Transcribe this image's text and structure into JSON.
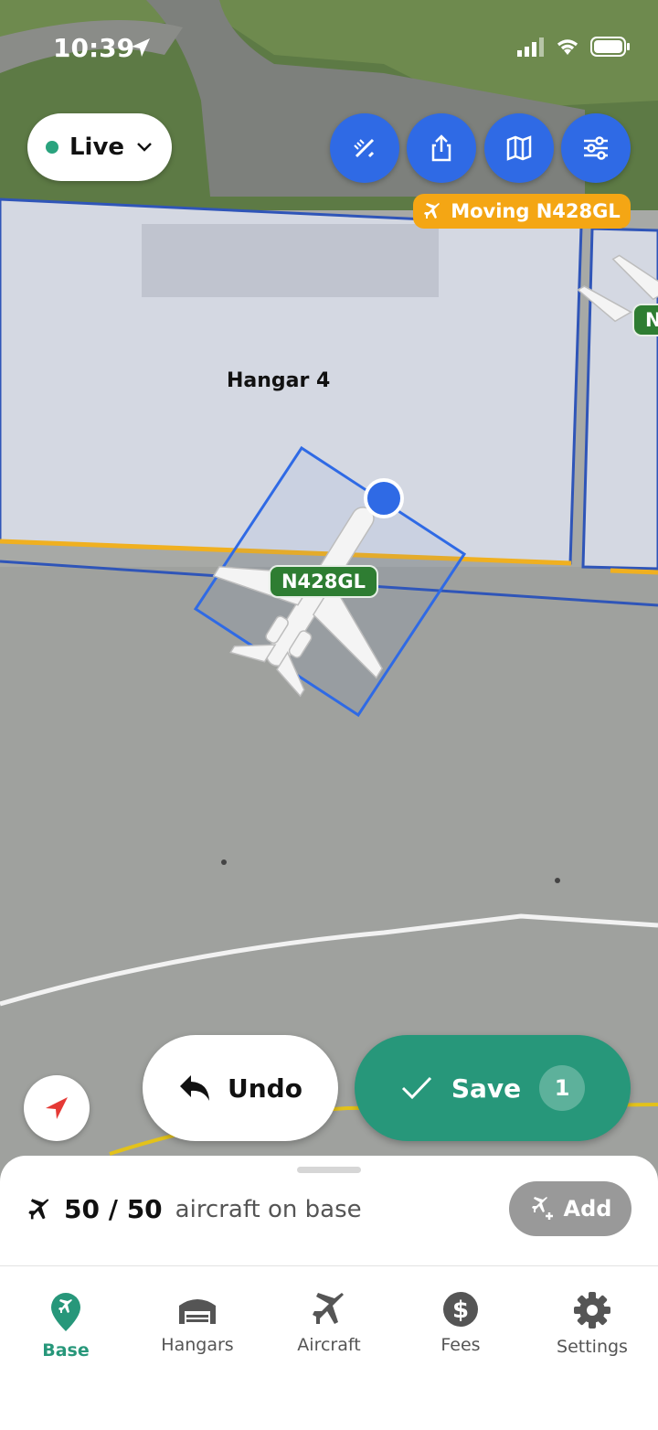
{
  "status_bar": {
    "time": "10:39"
  },
  "mode_selector": {
    "label": "Live",
    "status_color": "#2aa37e"
  },
  "toolbar": {
    "buttons": [
      {
        "name": "measure-tool-button",
        "icon": "pencil-ruler-icon"
      },
      {
        "name": "share-button",
        "icon": "share-icon"
      },
      {
        "name": "map-layers-button",
        "icon": "map-icon"
      },
      {
        "name": "filters-button",
        "icon": "sliders-icon"
      }
    ],
    "accent": "#2f6ae5"
  },
  "moving_badge": {
    "label": "Moving N428GL",
    "color": "#f4a614"
  },
  "map": {
    "hangar_name": "Hangar 4",
    "selected_aircraft": "N428GL",
    "edge_aircraft_label": "N"
  },
  "actions": {
    "undo_label": "Undo",
    "save_label": "Save",
    "save_count": "1",
    "save_color": "#27977a"
  },
  "summary": {
    "count": "50 / 50",
    "suffix": "aircraft on base",
    "add_label": "Add"
  },
  "tabs": [
    {
      "label": "Base",
      "icon": "location-plane-icon",
      "active": true
    },
    {
      "label": "Hangars",
      "icon": "hangar-icon",
      "active": false
    },
    {
      "label": "Aircraft",
      "icon": "airplane-icon",
      "active": false
    },
    {
      "label": "Fees",
      "icon": "dollar-icon",
      "active": false
    },
    {
      "label": "Settings",
      "icon": "gear-icon",
      "active": false
    }
  ]
}
